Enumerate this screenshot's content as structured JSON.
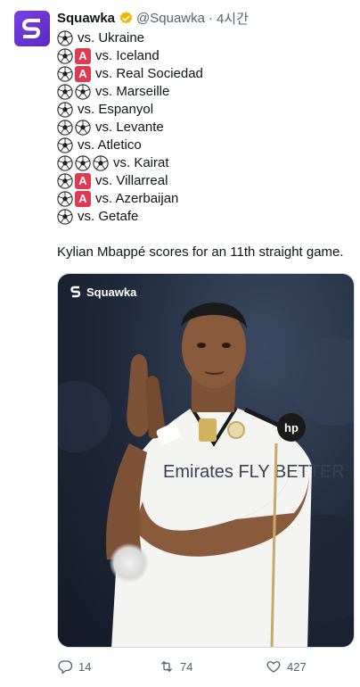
{
  "author": {
    "name": "Squawka",
    "handle": "@Squawka",
    "separator": "·",
    "time": "4시간",
    "verified_color": "#f4b400",
    "avatar_icon": "squawka-logo-icon"
  },
  "results": [
    {
      "icons": [
        "soccer-ball"
      ],
      "text": "vs. Ukraine"
    },
    {
      "icons": [
        "soccer-ball",
        "A"
      ],
      "text": "vs. Iceland"
    },
    {
      "icons": [
        "soccer-ball",
        "A"
      ],
      "text": "vs. Real Sociedad"
    },
    {
      "icons": [
        "soccer-ball",
        "soccer-ball"
      ],
      "text": "vs. Marseille"
    },
    {
      "icons": [
        "soccer-ball"
      ],
      "text": "vs. Espanyol"
    },
    {
      "icons": [
        "soccer-ball",
        "soccer-ball"
      ],
      "text": "vs. Levante"
    },
    {
      "icons": [
        "soccer-ball"
      ],
      "text": "vs. Atletico"
    },
    {
      "icons": [
        "soccer-ball",
        "soccer-ball",
        "soccer-ball"
      ],
      "text": "vs. Kairat"
    },
    {
      "icons": [
        "soccer-ball",
        "A"
      ],
      "text": "vs. Villarreal"
    },
    {
      "icons": [
        "soccer-ball",
        "A"
      ],
      "text": "vs. Azerbaijan"
    },
    {
      "icons": [
        "soccer-ball"
      ],
      "text": "vs. Getafe"
    }
  ],
  "assist_label": "A",
  "caption": "Kylian Mbappé scores for an 11th straight game.",
  "media": {
    "logo_text": "Squawka",
    "sponsor": "Emirates FLY BETTER",
    "kit_logo": "hp"
  },
  "actions": {
    "replies": "14",
    "retweets": "74",
    "likes": "427"
  },
  "colors": {
    "assist_badge": "#e03a52",
    "avatar": "#6a35d4",
    "muted_text": "#536471"
  }
}
